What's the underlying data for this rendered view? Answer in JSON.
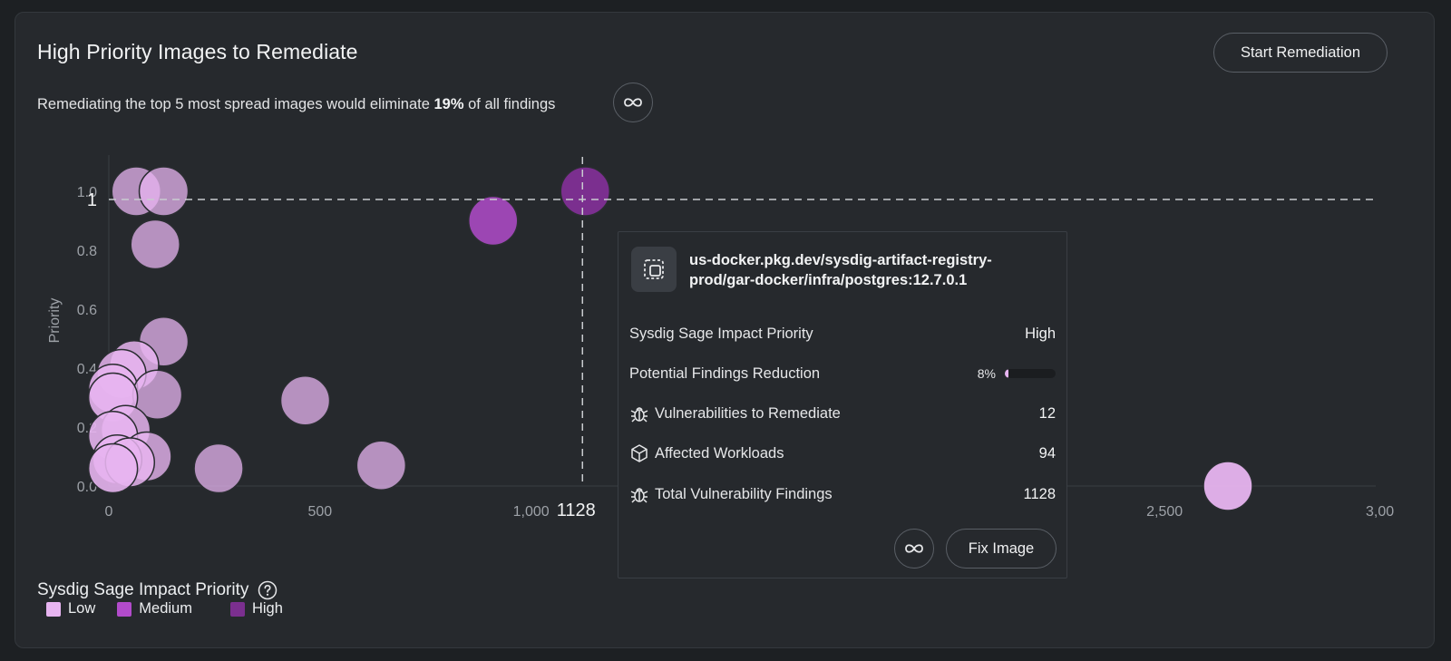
{
  "panel": {
    "title": "High Priority Images to Remediate",
    "start_button": "Start Remediation",
    "subtitle_prefix": "Remediating the top 5 most spread images would eliminate ",
    "subtitle_percent": "19%",
    "subtitle_suffix": " of all findings"
  },
  "colors": {
    "low": "#e7b4f0",
    "medium": "#b24bcb",
    "high": "#7b2f8f",
    "card_bg": "#26292d"
  },
  "chart_data": {
    "type": "scatter",
    "xlabel": "",
    "ylabel": "Priority",
    "x_ticks": [
      "0",
      "500",
      "1,000",
      "2,500",
      "3,00"
    ],
    "x_tick_values": [
      0,
      500,
      1000,
      2500,
      3000
    ],
    "y_ticks": [
      "0.0",
      "0.2",
      "0.4",
      "0.6",
      "0.8",
      "1.0"
    ],
    "y_tick_values": [
      0,
      0.2,
      0.4,
      0.6,
      0.8,
      1.0
    ],
    "xlim": [
      0,
      3000
    ],
    "ylim": [
      0,
      1.0
    ],
    "crosshair": {
      "x": 1128,
      "y": 1,
      "x_label": "1128",
      "y_label": "1"
    },
    "points": [
      {
        "x": 65,
        "y": 1.0,
        "level": "low",
        "opacity": 0.75
      },
      {
        "x": 130,
        "y": 1.0,
        "level": "low",
        "opacity": 0.75
      },
      {
        "x": 110,
        "y": 0.82,
        "level": "low",
        "opacity": 0.75
      },
      {
        "x": 130,
        "y": 0.49,
        "level": "low",
        "opacity": 0.75
      },
      {
        "x": 60,
        "y": 0.41,
        "level": "low",
        "opacity": 0.85
      },
      {
        "x": 30,
        "y": 0.38,
        "level": "low",
        "opacity": 0.85
      },
      {
        "x": 10,
        "y": 0.33,
        "level": "low",
        "opacity": 0.9
      },
      {
        "x": 115,
        "y": 0.31,
        "level": "low",
        "opacity": 0.75
      },
      {
        "x": 10,
        "y": 0.3,
        "level": "low",
        "opacity": 0.9
      },
      {
        "x": 465,
        "y": 0.29,
        "level": "low",
        "opacity": 0.75
      },
      {
        "x": 40,
        "y": 0.19,
        "level": "low",
        "opacity": 0.85
      },
      {
        "x": 10,
        "y": 0.17,
        "level": "low",
        "opacity": 0.9
      },
      {
        "x": 90,
        "y": 0.1,
        "level": "low",
        "opacity": 0.8
      },
      {
        "x": 20,
        "y": 0.09,
        "level": "low",
        "opacity": 0.9
      },
      {
        "x": 50,
        "y": 0.08,
        "level": "low",
        "opacity": 0.85
      },
      {
        "x": 10,
        "y": 0.06,
        "level": "low",
        "opacity": 0.9
      },
      {
        "x": 260,
        "y": 0.06,
        "level": "low",
        "opacity": 0.75
      },
      {
        "x": 645,
        "y": 0.07,
        "level": "low",
        "opacity": 0.75
      },
      {
        "x": 910,
        "y": 0.9,
        "level": "medium",
        "opacity": 0.85
      },
      {
        "x": 1128,
        "y": 1.0,
        "level": "high",
        "opacity": 1.0
      },
      {
        "x": 2650,
        "y": 0.0,
        "level": "low",
        "opacity": 0.95
      }
    ]
  },
  "tooltip": {
    "image_name": "us-docker.pkg.dev/sysdig-artifact-registry-prod/gar-docker/infra/postgres:12.7.0.1",
    "rows": {
      "priority_label": "Sysdig Sage Impact Priority",
      "priority_value": "High",
      "reduction_label": "Potential Findings Reduction",
      "reduction_value": "8%",
      "reduction_fraction": 0.08,
      "vulns_label": "Vulnerabilities to Remediate",
      "vulns_value": "12",
      "workloads_label": "Affected Workloads",
      "workloads_value": "94",
      "total_label": "Total Vulnerability Findings",
      "total_value": "1128"
    },
    "fix_button": "Fix Image"
  },
  "legend": {
    "title": "Sysdig Sage Impact Priority",
    "items": [
      "Low",
      "Medium",
      "High"
    ]
  },
  "icons": {
    "sage": "infinity-icon",
    "help": "question-circle-icon",
    "image": "container-image-icon",
    "bug": "bug-icon",
    "cube": "cube-icon"
  }
}
